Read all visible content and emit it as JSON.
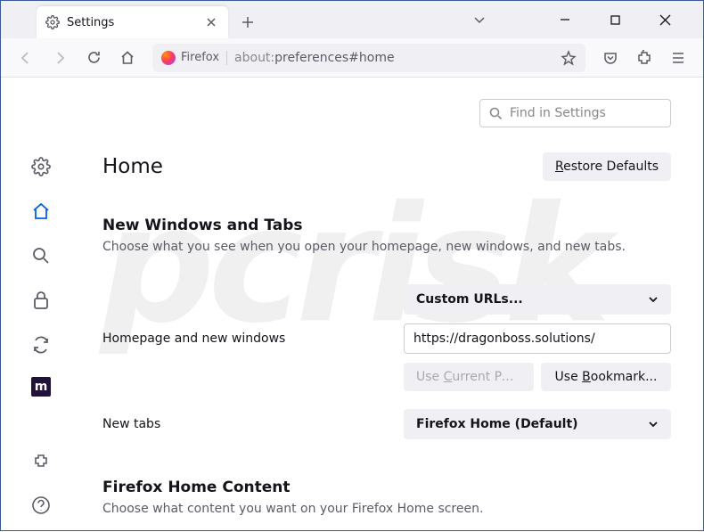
{
  "window": {
    "tab_title": "Settings",
    "url_identity": "Firefox",
    "url_prefix": "about:",
    "url_path": "preferences#home"
  },
  "search": {
    "placeholder": "Find in Settings"
  },
  "page": {
    "title": "Home",
    "restore_btn": "Restore Defaults"
  },
  "section1": {
    "title": "New Windows and Tabs",
    "desc": "Choose what you see when you open your homepage, new windows, and new tabs."
  },
  "homepage": {
    "label": "Homepage and new windows",
    "select": "Custom URLs...",
    "value": "https://dragonboss.solutions/",
    "use_current": "Use Current Pages",
    "use_bookmark": "Use Bookmark..."
  },
  "newtabs": {
    "label": "New tabs",
    "select": "Firefox Home (Default)"
  },
  "section2": {
    "title": "Firefox Home Content",
    "desc": "Choose what content you want on your Firefox Home screen."
  }
}
